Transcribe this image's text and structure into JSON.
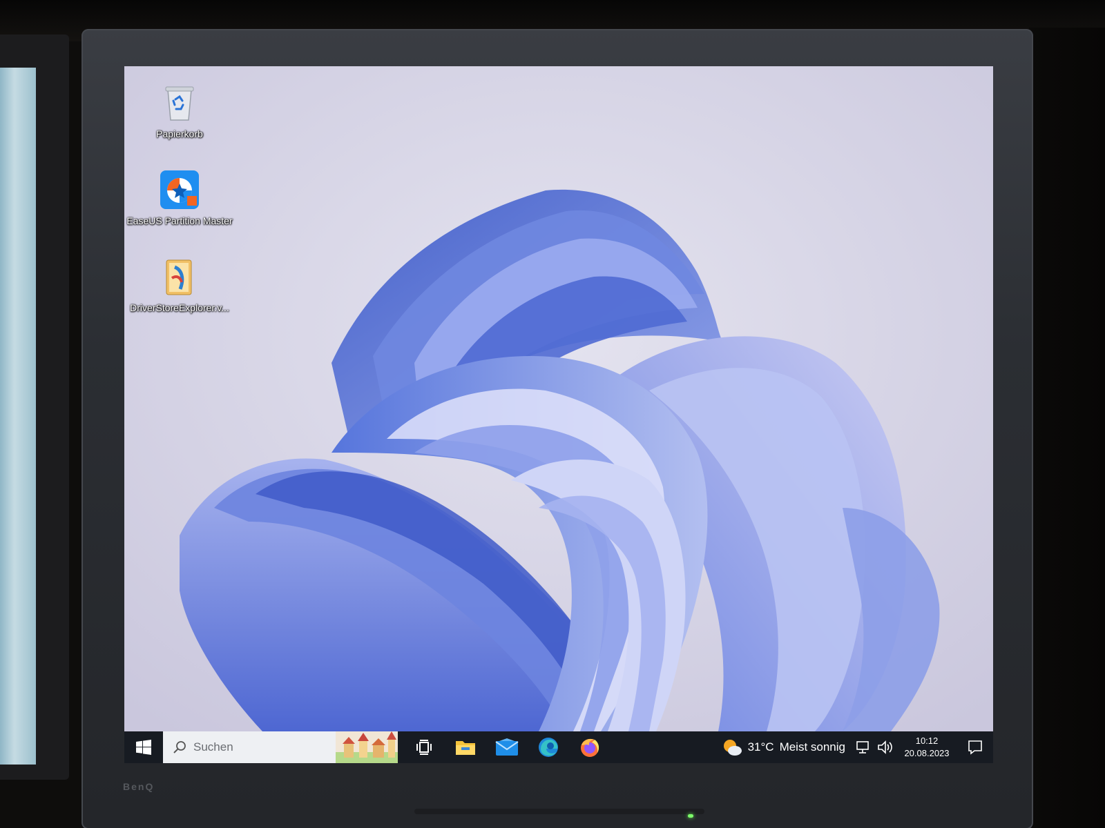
{
  "desktop": {
    "icons": [
      {
        "label": "Papierkorb",
        "icon": "recycle-bin-icon"
      },
      {
        "label": "EaseUS Partition Master",
        "icon": "easeus-partition-master-icon"
      },
      {
        "label": "DriverStoreExplorer.v...",
        "icon": "driverstore-explorer-icon"
      }
    ]
  },
  "taskbar": {
    "start_icon": "windows-logo-icon",
    "search_placeholder": "Suchen",
    "apps": [
      {
        "name": "task-view",
        "icon": "task-view-icon"
      },
      {
        "name": "file-explorer",
        "icon": "folder-icon"
      },
      {
        "name": "mail",
        "icon": "mail-icon"
      },
      {
        "name": "edge",
        "icon": "edge-icon"
      },
      {
        "name": "firefox",
        "icon": "firefox-icon"
      }
    ],
    "weather": {
      "temperature": "31°C",
      "condition": "Meist sonnig",
      "icon": "sun-cloud-icon"
    },
    "tray_icons": [
      "network-icon",
      "volume-icon"
    ],
    "clock": {
      "time": "10:12",
      "date": "20.08.2023"
    },
    "notification_icon": "notification-icon"
  },
  "monitor": {
    "brand": "BenQ"
  },
  "colors": {
    "taskbar": "#171b22",
    "search_box": "#eef0f3",
    "wallpaper_blue": "#4f6fd6",
    "wallpaper_light": "#c9c8e6"
  }
}
